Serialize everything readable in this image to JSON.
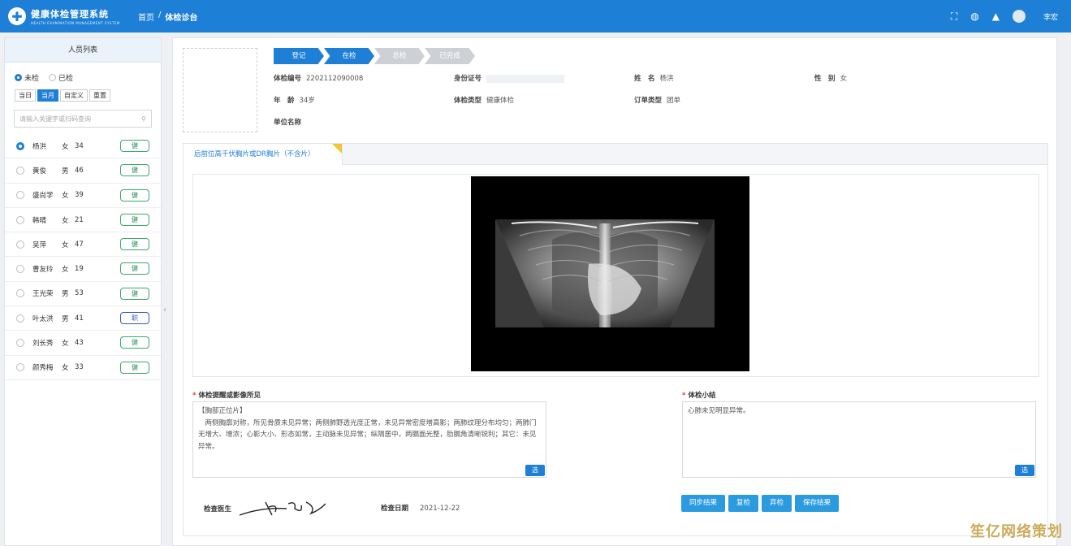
{
  "header": {
    "logo_cn": "健康体检管理系统",
    "logo_en": "HEALTH EXAMINATION MANAGEMENT SYSTEM",
    "breadcrumb": [
      "首页",
      "/",
      "体检诊台"
    ],
    "user": "李宏",
    "icons": [
      "fullscreen-icon",
      "globe-icon",
      "bell-icon",
      "avatar"
    ]
  },
  "sidebar": {
    "title": "人员列表",
    "radio_unchecked": "未检",
    "radio_checked": "已检",
    "filters": [
      "当日",
      "当月",
      "自定义",
      "重置"
    ],
    "search_placeholder": "请输入关键字或扫码查询",
    "people": [
      {
        "name": "杨洪",
        "sex": "女",
        "age": "34",
        "tag": "健"
      },
      {
        "name": "黄俊",
        "sex": "男",
        "age": "46",
        "tag": "健"
      },
      {
        "name": "盛尚学",
        "sex": "女",
        "age": "39",
        "tag": "健"
      },
      {
        "name": "韩晴",
        "sex": "女",
        "age": "21",
        "tag": "健"
      },
      {
        "name": "吴萍",
        "sex": "女",
        "age": "47",
        "tag": "健"
      },
      {
        "name": "曹友玲",
        "sex": "女",
        "age": "19",
        "tag": "健"
      },
      {
        "name": "王光荣",
        "sex": "男",
        "age": "53",
        "tag": "健"
      },
      {
        "name": "叶太洪",
        "sex": "男",
        "age": "41",
        "tag": "职"
      },
      {
        "name": "刘长秀",
        "sex": "女",
        "age": "43",
        "tag": "健"
      },
      {
        "name": "颜秀梅",
        "sex": "女",
        "age": "33",
        "tag": "健"
      }
    ]
  },
  "steps": [
    "登记",
    "在检",
    "总检",
    "已完成"
  ],
  "info": {
    "exam_no_label": "体检编号",
    "exam_no": "2202112090008",
    "id_label": "身份证号",
    "name_label": "姓　名",
    "name": "杨洪",
    "sex_label": "性　别",
    "sex": "女",
    "age_label": "年　龄",
    "age": "34岁",
    "type_label": "体检类型",
    "type": "健康体检",
    "order_label": "订单类型",
    "order": "团单",
    "unit_label": "单位名称"
  },
  "card": {
    "tab": "后前位高千伏胸片或DR胸片（不含片）",
    "findings_label": "体检提醒或影像所见",
    "findings_text": "【胸部正位片】\n　两侧胸廓对称，所见骨质未见异常；两侧肺野透光度正常，未见异常密度增高影；两肺纹理分布均匀；两肺门无增大、增浓；心影大小、形态如常，主动脉未见异常；纵隔居中，两膈面光整，肋膈角清晰锐利；其它：未见异常。",
    "summary_label": "体检小结",
    "summary_text": "心肺未见明显异常。",
    "pick": "选",
    "doctor_label": "检查医生",
    "date_label": "检查日期",
    "date": "2021-12-22",
    "buttons": [
      "同步结果",
      "复检",
      "弃检",
      "保存结果"
    ]
  },
  "watermark": "笙亿网络策划"
}
